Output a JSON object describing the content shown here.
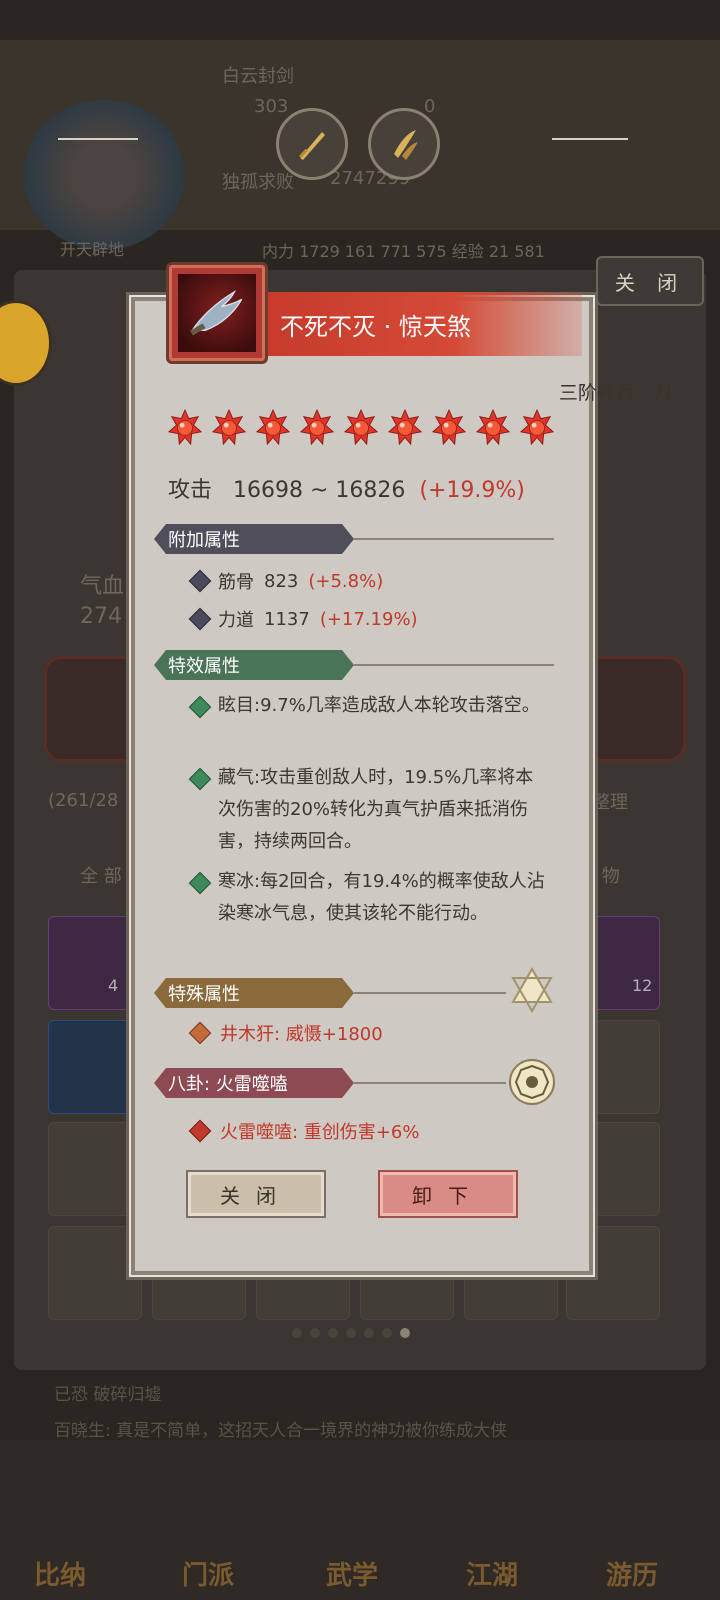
{
  "background": {
    "player_title": "白云封剑",
    "currency_1": "303",
    "currency_2": "0",
    "player_subtitle": "独孤求败",
    "player_power": "2747299",
    "tab_label": "开天辟地",
    "stats_line": "内力 1729 161 771 575 经验 21 581",
    "left_label": "气血",
    "left_value": "274",
    "capacity": "(261/28",
    "sort_button": "已整理",
    "filter_all": "全 部",
    "filter_misc": "杂 物",
    "slot_count_1": "4",
    "slot_count_2": "12",
    "chat_line_1": "已恐 破碎归墟",
    "chat_line_2": "百晓生: 真是不简单，这招天人合一境界的神功被你练成大侠",
    "nav": [
      "比纳",
      "门派",
      "武学",
      "江湖",
      "游历"
    ]
  },
  "top_close_button": "关 闭",
  "dialog": {
    "title": "不死不灭 · 惊天煞",
    "tier": "三阶神兵 · 刀",
    "star_count": 9,
    "attack": {
      "label": "攻击",
      "range": "16698 ~ 16826",
      "bonus": "(+19.9%)"
    },
    "sections": {
      "additional": {
        "header": "附加属性",
        "items": [
          {
            "name": "筋骨",
            "value": "823",
            "bonus": "(+5.8%)"
          },
          {
            "name": "力道",
            "value": "1137",
            "bonus": "(+17.19%)"
          }
        ]
      },
      "special_effects": {
        "header": "特效属性",
        "items": [
          "眩目:9.7%几率造成敌人本轮攻击落空。",
          "藏气:攻击重创敌人时，19.5%几率将本次伤害的20%转化为真气护盾来抵消伤害，持续两回合。",
          "寒冰:每2回合，有19.4%的概率使敌人沾染寒冰气息，使其该轮不能行动。"
        ]
      },
      "special_attr": {
        "header": "特殊属性",
        "value": "井木犴: 威慑+1800"
      },
      "bagua": {
        "header": "八卦: 火雷噬嗑",
        "value": "火雷噬嗑: 重创伤害+6%"
      }
    },
    "buttons": {
      "close": "关闭",
      "unequip": "卸下"
    }
  },
  "colors": {
    "title_banner": "#d44a36",
    "bonus_red": "#c0392b",
    "sec_additional": "#4f4e5a",
    "sec_effects": "#4a7457",
    "sec_special": "#8a6a3a",
    "sec_bagua": "#8e4a52"
  },
  "icons": [
    "sword-icon",
    "dagger-icon",
    "weapon-blade-icon",
    "star-gem-icon",
    "hexagram-emblem-icon",
    "bagua-emblem-icon"
  ]
}
